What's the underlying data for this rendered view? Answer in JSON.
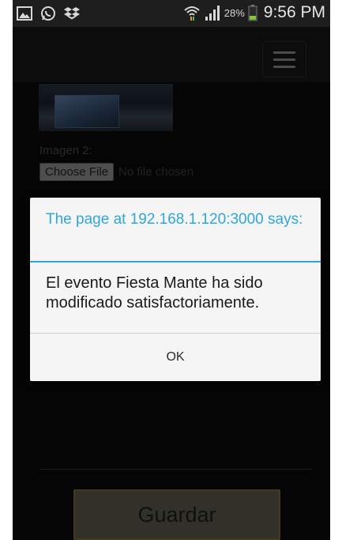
{
  "status_bar": {
    "battery_percent": "28%",
    "time": "9:56 PM",
    "icons": [
      "gallery-icon",
      "whatsapp-icon",
      "dropbox-icon",
      "wifi-icon",
      "signal-icon",
      "battery-icon"
    ]
  },
  "header": {
    "menu_icon": "hamburger-menu-icon"
  },
  "form": {
    "image2_label": "Imagen 2:",
    "choose_file_label": "Choose File",
    "file_status": "No file chosen",
    "save_label": "Guardar"
  },
  "dialog": {
    "title": "The page at 192.168.1.120:3000 says:",
    "message": "El evento Fiesta Mante ha sido modificado satisfactoriamente.",
    "ok_label": "OK"
  },
  "colors": {
    "accent": "#2fa8d8",
    "dialog_bg": "#f5f5f5",
    "page_bg": "#0b0b0b"
  }
}
